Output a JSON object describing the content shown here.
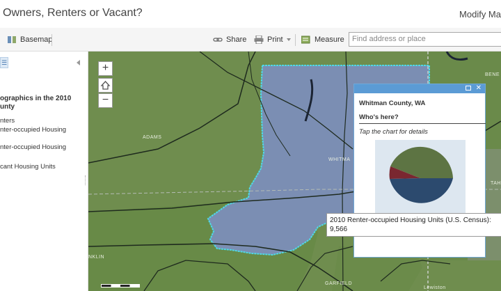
{
  "app": {
    "title": "Owners, Renters or Vacant?",
    "modify_label": "Modify Ma"
  },
  "toolbar": {
    "basemap_label": "Basemap",
    "share_label": "Share",
    "print_label": "Print",
    "measure_label": "Measure",
    "search_placeholder": "Find address or place"
  },
  "sidebar": {
    "heading": "ographics in the 2010 unty",
    "items": [
      "nters",
      "nter-occupied Housing",
      "nter-occupied Housing",
      "cant Housing Units"
    ]
  },
  "map": {
    "zoom_in": "+",
    "zoom_out": "−",
    "labels": [
      "ADAMS",
      "WHITMA",
      "BENE",
      "TAH",
      "NKLIN",
      "GARFIELD",
      "Lewiston"
    ]
  },
  "popup": {
    "title": "Whitman County, WA",
    "subtitle": "Who's here?",
    "note": "Tap the chart for details",
    "pie_colors": [
      "#5d7443",
      "#7a2730",
      "#2c4a6e"
    ]
  },
  "tooltip": {
    "text": "2010 Renter-occupied Housing Units (U.S. Census): 9,566"
  },
  "colors": {
    "county_fill": "#7b8eb3",
    "county_outline": "#4fd8e8",
    "land": "#6f8d4e",
    "popup_header": "#5b9bd5"
  }
}
